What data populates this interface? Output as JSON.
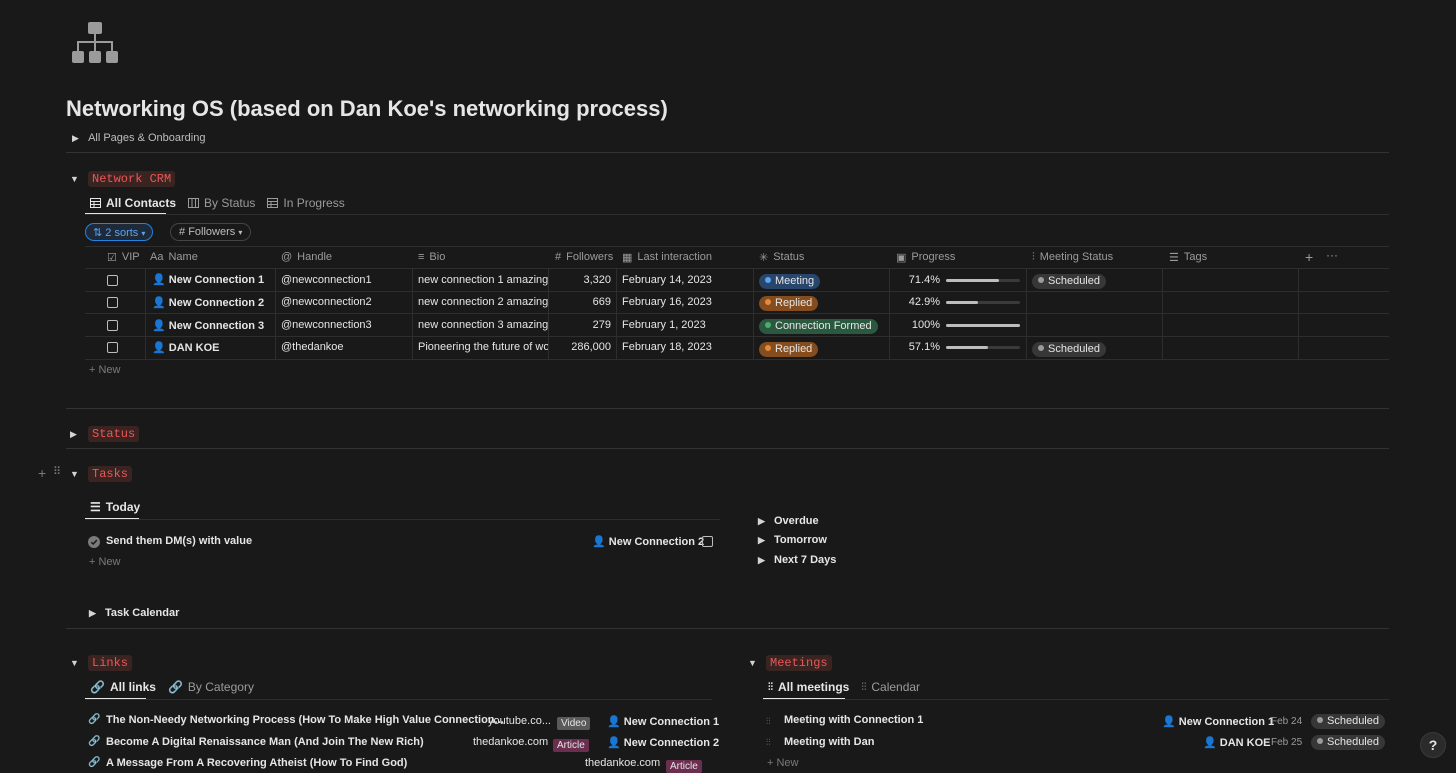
{
  "page": {
    "title": "Networking OS (based on Dan Koe's networking process)",
    "onboarding": "All Pages & Onboarding"
  },
  "crm": {
    "title": "Network CRM",
    "tabs": [
      "All Contacts",
      "By Status",
      "In Progress"
    ],
    "sorts": "2 sorts",
    "filter": "Followers",
    "headers": [
      "VIP",
      "Name",
      "Handle",
      "Bio",
      "Followers",
      "Last interaction",
      "Status",
      "Progress",
      "Meeting Status",
      "Tags"
    ],
    "name_prefix": "Aa",
    "rows": [
      {
        "name": "New Connection 1",
        "handle": "@newconnection1",
        "bio": "new connection 1 amazing bi",
        "followers": "3,320",
        "last": "February 14, 2023",
        "status": "Meeting",
        "progress": "71.4%",
        "progress_value": 0.714,
        "meeting": "Scheduled"
      },
      {
        "name": "New Connection 2",
        "handle": "@newconnection2",
        "bio": "new connection 2 amazing bi",
        "followers": "669",
        "last": "February 16, 2023",
        "status": "Replied",
        "progress": "42.9%",
        "progress_value": 0.429,
        "meeting": ""
      },
      {
        "name": "New Connection 3",
        "handle": "@newconnection3",
        "bio": "new connection 3 amazing bi",
        "followers": "279",
        "last": "February 1, 2023",
        "status": "Connection Formed",
        "progress": "100%",
        "progress_value": 1.0,
        "meeting": ""
      },
      {
        "name": "DAN KOE",
        "handle": "@thedankoe",
        "bio": "Pioneering the future of work",
        "followers": "286,000",
        "last": "February 18, 2023",
        "status": "Replied",
        "progress": "57.1%",
        "progress_value": 0.571,
        "meeting": "Scheduled"
      }
    ],
    "new_label": "New"
  },
  "status_section": {
    "title": "Status"
  },
  "tasks": {
    "title": "Tasks",
    "tab": "Today",
    "task": "Send them DM(s) with value",
    "task_person": "New Connection 2",
    "new_label": "New",
    "groups": [
      "Overdue",
      "Tomorrow",
      "Next 7 Days"
    ],
    "calendar": "Task Calendar"
  },
  "links": {
    "title": "Links",
    "tabs": [
      "All links",
      "By Category"
    ],
    "items": [
      {
        "title": "The Non-Needy Networking Process (How To Make High Value Connection...",
        "site": "youtube.co...",
        "type": "Video",
        "person": "New Connection 1"
      },
      {
        "title": "Become A Digital Renaissance Man (And Join The New Rich)",
        "site": "thedankoe.com",
        "type": "Article",
        "person": "New Connection 2"
      },
      {
        "title": "A Message From A Recovering Atheist (How To Find God)",
        "site": "thedankoe.com",
        "type": "Article",
        "person": ""
      }
    ]
  },
  "meetings": {
    "title": "Meetings",
    "tabs": [
      "All meetings",
      "Calendar"
    ],
    "items": [
      {
        "title": "Meeting with Connection 1",
        "person": "New Connection 1",
        "date": "Feb 24",
        "status": "Scheduled"
      },
      {
        "title": "Meeting with Dan",
        "person": "DAN KOE",
        "date": "Feb 25",
        "status": "Scheduled"
      }
    ],
    "new_label": "New"
  },
  "help": "?",
  "colors": {
    "status_meeting": "#28456c",
    "status_replied": "#854c1d",
    "status_formed": "#2b593f",
    "scheduled": "#373737",
    "accent": "#2383e2",
    "title_red": "#eb5757"
  }
}
